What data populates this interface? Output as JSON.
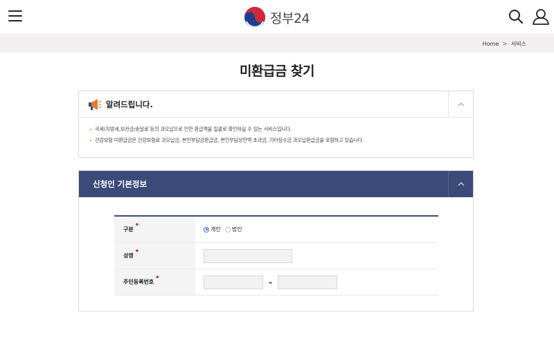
{
  "header": {
    "logo_text": "정부24",
    "menu_icon": "hamburger-menu-icon",
    "search_icon": "search-icon",
    "user_icon": "user-icon"
  },
  "breadcrumb": {
    "home": "Home",
    "separator": ">",
    "current": "서비스"
  },
  "page": {
    "title": "미환급금 찾기"
  },
  "notice": {
    "icon": "megaphone-icon",
    "title": "알려드립니다.",
    "items": [
      "국세(지방세,보관금/송달료 등의 과오납으로 인한 환급액을 일괄로 확인하실 수 있는 서비스입니다.",
      "건강보험 미환급금은 건강보험료 과오납금, 본인부담금환급금, 본인부담상한액 초과금, 기타징수금 과오납환급금을 포함하고 있습니다."
    ]
  },
  "applicant": {
    "title": "신청인 기본정보",
    "type_label": "구분",
    "type_options": [
      "개인",
      "법인"
    ],
    "type_selected": "개인",
    "name_label": "성명",
    "name_value": "",
    "rrn_label": "주민등록번호",
    "rrn_front": "",
    "rrn_back": "",
    "rrn_separator": "-",
    "required_mark": "•"
  },
  "colors": {
    "panel_header": "#3b4a78",
    "required": "#d0282e",
    "breadcrumb_bg": "#f2eff0"
  }
}
